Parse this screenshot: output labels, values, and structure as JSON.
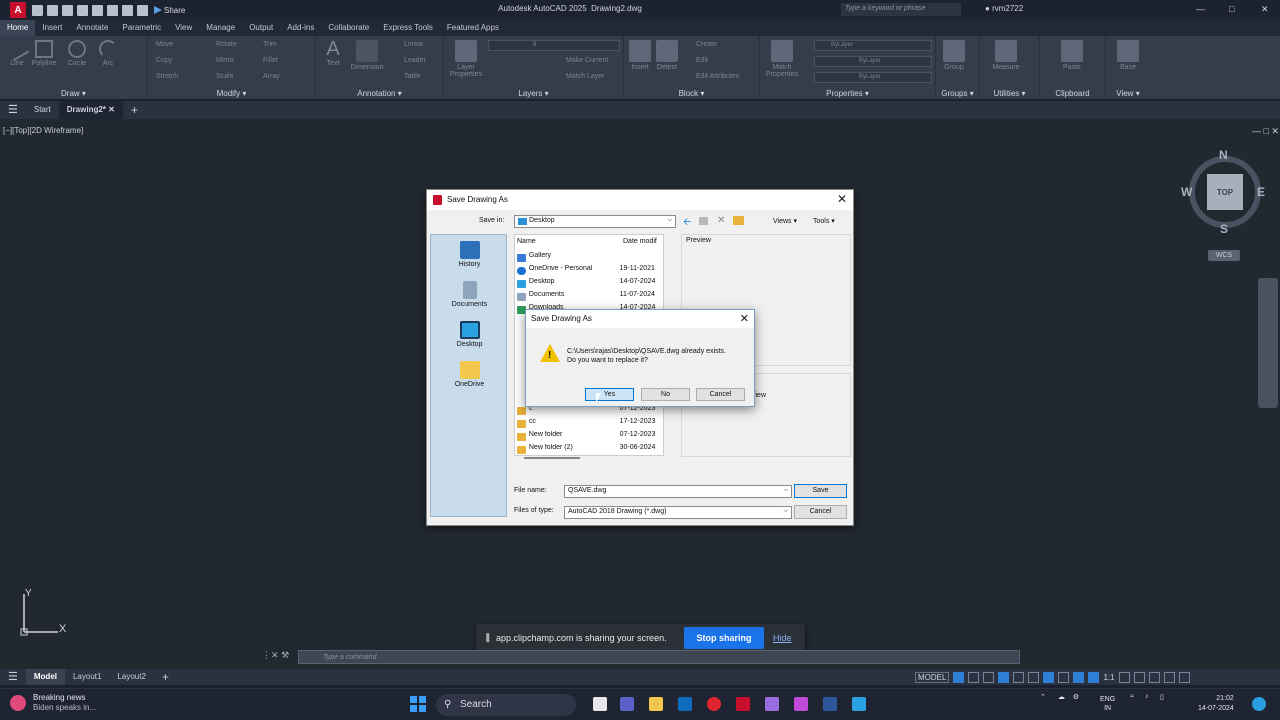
{
  "app": {
    "title": "Autodesk AutoCAD 2025",
    "doc": "Drawing2.dwg",
    "share": "Share",
    "search_placeholder": "Type a keyword or phrase",
    "user": "rvm2722"
  },
  "menu_tabs": [
    "Home",
    "Insert",
    "Annotate",
    "Parametric",
    "View",
    "Manage",
    "Output",
    "Add-ins",
    "Collaborate",
    "Express Tools",
    "Featured Apps"
  ],
  "ribbon": {
    "draw": {
      "label": "Draw",
      "tools": [
        "Line",
        "Polyline",
        "Circle",
        "Arc"
      ]
    },
    "modify": {
      "label": "Modify",
      "rows": [
        [
          "Move",
          "Rotate",
          "Trim"
        ],
        [
          "Copy",
          "Mirror",
          "Fillet"
        ],
        [
          "Stretch",
          "Scale",
          "Array"
        ]
      ]
    },
    "annotation": {
      "label": "Annotation",
      "tools": [
        "Text",
        "Dimension"
      ],
      "rows": [
        "Linear",
        "Leader",
        "Table"
      ]
    },
    "layers": {
      "label": "Layers",
      "props": "Layer Properties",
      "rows": [
        "Make Current",
        "Match Layer"
      ],
      "current": "0"
    },
    "block": {
      "label": "Block",
      "tools": [
        "Insert",
        "Detect"
      ],
      "rows": [
        "Create",
        "Edit",
        "Edit Attributes"
      ]
    },
    "properties": {
      "label": "Properties",
      "match": "Match Properties",
      "bylayer": [
        "ByLayer",
        "ByLayer",
        "ByLayer"
      ]
    },
    "groups": {
      "label": "Groups",
      "tool": "Group"
    },
    "utilities": {
      "label": "Utilities",
      "tool": "Measure"
    },
    "clipboard": {
      "label": "Clipboard",
      "tool": "Paste"
    },
    "view": {
      "label": "View",
      "tool": "Base"
    }
  },
  "doc_tabs": {
    "start": "Start",
    "drawing": "Drawing2*"
  },
  "viewport": {
    "label": "[−][Top][2D Wireframe]"
  },
  "viewcube": {
    "n": "N",
    "s": "S",
    "e": "E",
    "w": "W",
    "top": "TOP",
    "wcs": "WCS"
  },
  "ucs": {
    "x": "X",
    "y": "Y"
  },
  "save_dialog": {
    "title": "Save Drawing As",
    "save_in_label": "Save in:",
    "save_in_value": "Desktop",
    "views": "Views",
    "tools": "Tools",
    "places": [
      "History",
      "Documents",
      "Desktop",
      "OneDrive"
    ],
    "columns": {
      "name": "Name",
      "date": "Date modif"
    },
    "files": [
      {
        "name": "Gallery",
        "date": ""
      },
      {
        "name": "OneDrive - Personal",
        "date": "19-11-2021"
      },
      {
        "name": "Desktop",
        "date": "14-07-2024"
      },
      {
        "name": "Documents",
        "date": "11-07-2024"
      },
      {
        "name": "Downloads",
        "date": "14-07-2024"
      },
      {
        "name": "c",
        "date": "07-12-2023"
      },
      {
        "name": "cc",
        "date": "17-12-2023"
      },
      {
        "name": "New folder",
        "date": "07-12-2023"
      },
      {
        "name": "New folder (2)",
        "date": "30-06-2024"
      }
    ],
    "preview_label": "Preview",
    "preview_partial": "view",
    "file_name_label": "File name:",
    "file_name_value": "QSAVE.dwg",
    "file_type_label": "Files of type:",
    "file_type_value": "AutoCAD 2018 Drawing (*.dwg)",
    "save_btn": "Save",
    "cancel_btn": "Cancel"
  },
  "confirm_dialog": {
    "title": "Save Drawing As",
    "line1": "C:\\Users\\rajas\\Desktop\\QSAVE.dwg already exists.",
    "line2": "Do you want to replace it?",
    "yes": "Yes",
    "no": "No",
    "cancel": "Cancel"
  },
  "share_bar": {
    "text": "app.clipchamp.com is sharing your screen.",
    "stop": "Stop sharing",
    "hide": "Hide"
  },
  "command": {
    "placeholder": "Type a command"
  },
  "layout_tabs": [
    "Model",
    "Layout1",
    "Layout2"
  ],
  "status": {
    "model": "MODEL",
    "scale": "1:1"
  },
  "taskbar": {
    "news_title": "Breaking news",
    "news_sub": "Biden speaks in...",
    "search": "Search",
    "lang1": "ENG",
    "lang2": "IN",
    "time": "21:02",
    "date": "14-07-2024"
  },
  "colors": {
    "accent": "#1a73e8",
    "autocad_red": "#c8102e",
    "ribbon_bg": "#353d4b",
    "canvas_bg": "#212830"
  }
}
